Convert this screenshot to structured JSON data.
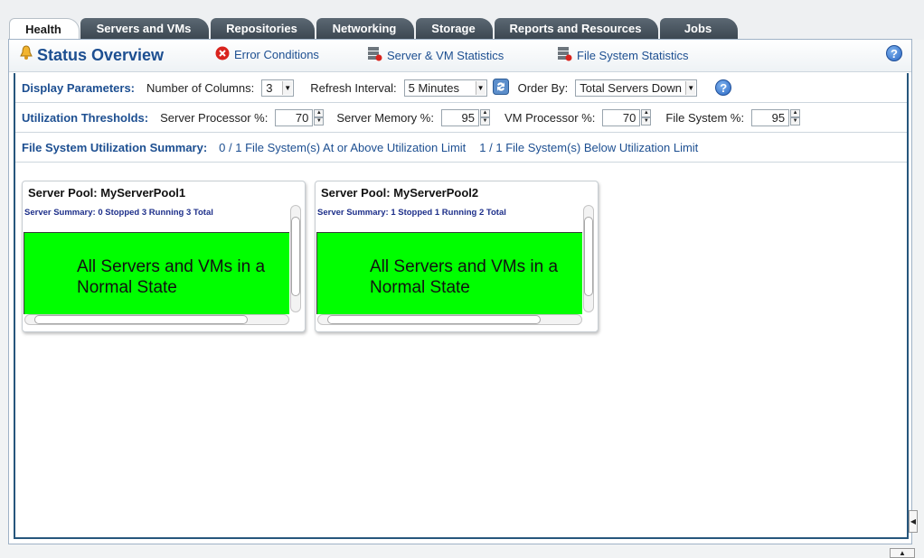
{
  "tabs": [
    {
      "label": "Health",
      "active": true
    },
    {
      "label": "Servers and VMs"
    },
    {
      "label": "Repositories"
    },
    {
      "label": "Networking"
    },
    {
      "label": "Storage"
    },
    {
      "label": "Reports and Resources"
    },
    {
      "label": "Jobs"
    }
  ],
  "header": {
    "title": "Status Overview",
    "links": {
      "errors": "Error Conditions",
      "server_vm_stats": "Server & VM Statistics",
      "fs_stats": "File System Statistics"
    },
    "help": "?"
  },
  "display": {
    "label": "Display Parameters:",
    "columns_label": "Number of Columns:",
    "columns_value": "3",
    "refresh_label": "Refresh Interval:",
    "refresh_value": "5 Minutes",
    "order_label": "Order By:",
    "order_value": "Total Servers Down",
    "help": "?"
  },
  "thresholds": {
    "label": "Utilization Thresholds:",
    "server_proc_label": "Server Processor %:",
    "server_proc_value": "70",
    "server_mem_label": "Server Memory %:",
    "server_mem_value": "95",
    "vm_proc_label": "VM Processor %:",
    "vm_proc_value": "70",
    "fs_label": "File System %:",
    "fs_value": "95"
  },
  "fs_summary": {
    "label": "File System Utilization Summary:",
    "above": "0 / 1 File System(s) At or Above Utilization Limit",
    "below": "1 / 1 File System(s) Below Utilization Limit"
  },
  "pools": [
    {
      "title": "Server Pool: MyServerPool1",
      "summary": "Server Summary: 0 Stopped 3 Running 3 Total",
      "state": "All Servers and VMs in a Normal State"
    },
    {
      "title": "Server Pool: MyServerPool2",
      "summary": "Server Summary: 1 Stopped 1 Running 2 Total",
      "state": "All Servers and VMs in a Normal State"
    }
  ],
  "colors": {
    "normal_state": "#00ff00",
    "accent": "#1d4f91"
  }
}
